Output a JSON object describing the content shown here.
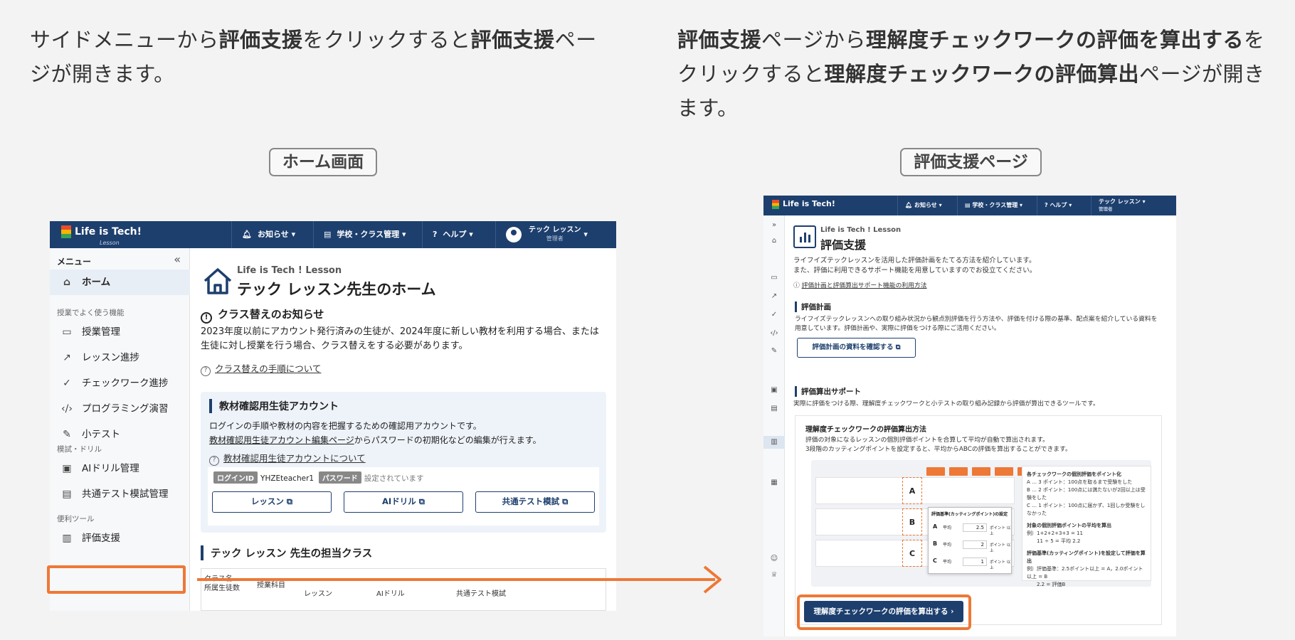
{
  "captions": {
    "left": [
      {
        "t": "サイドメニューから",
        "b": false
      },
      {
        "t": "評価支援",
        "b": true
      },
      {
        "t": "をクリックすると",
        "b": false
      },
      {
        "t": "評価支援",
        "b": true
      },
      {
        "t": "ページが開きます。",
        "b": false
      }
    ],
    "right": [
      {
        "t": "評価支援",
        "b": true
      },
      {
        "t": "ページから",
        "b": false
      },
      {
        "t": "理解度チェックワークの評価を算出する",
        "b": true
      },
      {
        "t": "をクリックすると",
        "b": false
      },
      {
        "t": "理解度チェックワークの評価算出",
        "b": true
      },
      {
        "t": "ページが開きます。",
        "b": false
      }
    ]
  },
  "labels": {
    "home_screen": "ホーム画面",
    "eval_page": "評価支援ページ"
  },
  "colors": {
    "navy": "#1d3f6e",
    "accent_orange": "#ee7836"
  },
  "home": {
    "logo": "Life is Tech!",
    "logo_sub": "Lesson",
    "topbar": {
      "news": "お知らせ",
      "school": "学校・クラス管理",
      "help": "ヘルプ",
      "user_name": "テック レッスン",
      "user_role": "管理者"
    },
    "sidebar": {
      "menu_label": "メニュー",
      "home": "ホーム",
      "group1": "授業でよく使う機能",
      "items1": [
        {
          "label": "授業管理",
          "icon": "monitor-icon"
        },
        {
          "label": "レッスン進捗",
          "icon": "trend-icon"
        },
        {
          "label": "チェックワーク進捗",
          "icon": "check-circle-icon"
        },
        {
          "label": "プログラミング演習",
          "icon": "code-icon"
        },
        {
          "label": "小テスト",
          "icon": "pen-icon"
        }
      ],
      "group2": "模試・ドリル",
      "items2": [
        {
          "label": "AIドリル管理",
          "icon": "drill-icon"
        },
        {
          "label": "共通テスト模試管理",
          "icon": "exam-icon"
        }
      ],
      "group3": "便利ツール",
      "eval": "評価支援"
    },
    "page_sub": "Life is Tech ! Lesson",
    "page_title": "テック レッスン先生のホーム",
    "notice_title": "クラス替えのお知らせ",
    "notice_text": "2023年度以前にアカウント発行済みの生徒が、2024年度に新しい教材を利用する場合、または生徒に対し授業を行う場合、クラス替えをする必要があります。",
    "notice_link": "クラス替えの手順について",
    "acct": {
      "title": "教材確認用生徒アカウント",
      "text1": "ログインの手順や教材の内容を把握するための確認用アカウントです。",
      "text2_link": "教材確認用生徒アカウント編集ページ",
      "text2_rest": "からパスワードの初期化などの編集が行えます。",
      "help_link": "教材確認用生徒アカウントについて",
      "login_badge": "ログインID",
      "login_id": "YHZEteacher1",
      "pw_badge": "パスワード",
      "pw_text": "設定されています",
      "btn_lesson": "レッスン",
      "btn_ai": "AIドリル",
      "btn_exam": "共通テスト模試"
    },
    "class_title": "テック レッスン 先生の担当クラス",
    "class_cols": {
      "c1": "クラス名",
      "c1b": "所属生徒数",
      "c2": "授業科目",
      "c3": "レッスン",
      "c4": "AIドリル",
      "c5": "共通テスト模試"
    }
  },
  "eval": {
    "logo": "Life is Tech!",
    "topbar": {
      "news": "お知らせ",
      "school": "学校・クラス管理",
      "help": "ヘルプ",
      "user_name": "テック レッスン",
      "user_role": "管理者"
    },
    "page_sub": "Life is Tech ! Lesson",
    "page_title": "評価支援",
    "desc1": "ライフイズテックレッスンを活用した評価計画をたてる方法を紹介しています。",
    "desc2": "また、評価に利用できるサポート機能を用意していますのでお役立てください。",
    "help_link": "評価計画と評価算出サポート機能の利用方法",
    "plan_title": "評価計画",
    "plan_text": "ライフイズテックレッスンへの取り組み状況から観点別評価を行う方法や、評価を付ける際の基準、配点案を紹介している資料を用意しています。評価計画や、実際に評価をつける際にご活用ください。",
    "plan_btn": "評価計画の資料を確認する",
    "support_title": "評価算出サポート",
    "support_text": "実際に評価をつける際、理解度チェックワークと小テストの取り組み記録から評価が算出できるツールです。",
    "card_title": "理解度チェックワークの評価算出方法",
    "card_text1": "評価の対象になるレッスンの個別評価ポイントを合算して平均が自動で算出されます。",
    "card_text2": "3段階のカッティングポイントを設定すると、平均からABCの評価を算出することができます。",
    "grades": [
      "A",
      "B",
      "C"
    ],
    "popup": {
      "title": "評価基準(カッティングポイント)の設定",
      "rows": [
        {
          "g": "A",
          "v": "2.5"
        },
        {
          "g": "B",
          "v": "2"
        },
        {
          "g": "C",
          "v": "1"
        }
      ],
      "unit": "ポイント 以上",
      "avg": "平均"
    },
    "note": {
      "h1": "各チェックワークの個別評価をポイント化",
      "l1": "A … 3 ポイント：100点を取るまで受験をした",
      "l2": "B … 2 ポイント：100点には満たないが2回以上は受験をした",
      "l3": "C … 1 ポイント：100点に届かず、1回しか受験をしなかった",
      "h2": "対象の個別評価ポイントの平均を算出",
      "ex1": "例）1+2+2+3+3 = 11",
      "ex2": "11 ÷ 5 = 平均 2.2",
      "h3": "評価基準(カッティングポイント)を設定して評価を算出",
      "ex3": "例）評価基準：2.5ポイント以上 = A，2.0ポイント以上 = B",
      "ex4": "2.2 = 評価B"
    },
    "calc_btn": "理解度チェックワークの評価を算出する"
  }
}
